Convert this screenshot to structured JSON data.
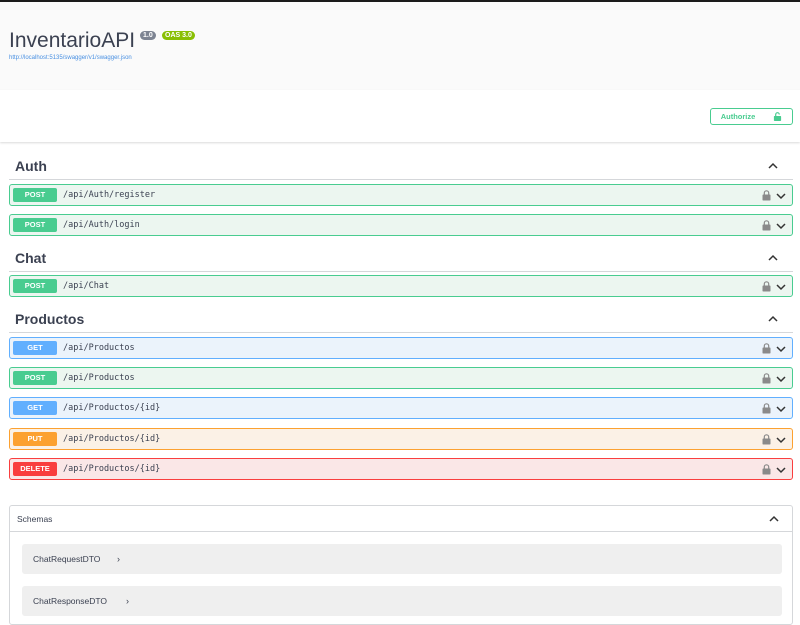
{
  "info": {
    "title": "InventarioAPI",
    "version": "1.0",
    "oas": "OAS 3.0",
    "spec_url": "http://localhost:5135/swagger/v1/swagger.json"
  },
  "authorize": {
    "label": "Authorize"
  },
  "tags": [
    {
      "name": "Auth",
      "operations": [
        {
          "method": "POST",
          "path": "/api/Auth/register"
        },
        {
          "method": "POST",
          "path": "/api/Auth/login"
        }
      ]
    },
    {
      "name": "Chat",
      "operations": [
        {
          "method": "POST",
          "path": "/api/Chat"
        }
      ]
    },
    {
      "name": "Productos",
      "operations": [
        {
          "method": "GET",
          "path": "/api/Productos"
        },
        {
          "method": "POST",
          "path": "/api/Productos"
        },
        {
          "method": "GET",
          "path": "/api/Productos/{id}"
        },
        {
          "method": "PUT",
          "path": "/api/Productos/{id}"
        },
        {
          "method": "DELETE",
          "path": "/api/Productos/{id}"
        }
      ]
    }
  ],
  "schemas": {
    "title": "Schemas",
    "models": [
      "ChatRequestDTO",
      "ChatResponseDTO"
    ]
  },
  "colors": {
    "post": "#49cc90",
    "get": "#61affe",
    "put": "#fca130",
    "delete": "#f93e3e"
  }
}
